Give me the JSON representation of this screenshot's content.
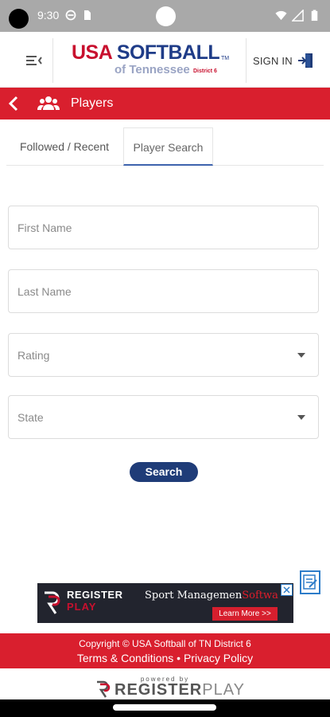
{
  "status_bar": {
    "time": "9:30"
  },
  "header": {
    "logo": {
      "usa": "USA",
      "softball": "SOFTBALL",
      "tm": "TM",
      "state": "of Tennessee",
      "district": "District 6"
    },
    "sign_in_label": "SIGN IN"
  },
  "section": {
    "title": "Players"
  },
  "tabs": [
    {
      "label": "Followed / Recent",
      "active": false
    },
    {
      "label": "Player Search",
      "active": true
    }
  ],
  "form": {
    "first_name_placeholder": "First Name",
    "last_name_placeholder": "Last Name",
    "rating_label": "Rating",
    "state_label": "State",
    "search_label": "Search"
  },
  "ad": {
    "brand_top": "REGISTER",
    "brand_bottom": "PLAY",
    "tagline_main": "Sport Managemen",
    "tagline_accent": "Softwa",
    "cta": "Learn More >>"
  },
  "footer": {
    "copyright": "Copyright © USA Softball of TN District 6",
    "terms": "Terms & Conditions",
    "separator": "•",
    "privacy": "Privacy Policy",
    "powered_by": "powered by",
    "powered_register": "REGISTER",
    "powered_play": "PLAY"
  },
  "colors": {
    "brand_red": "#d91f2e",
    "brand_navy": "#1f3c78",
    "tab_underline": "#3d63ad"
  },
  "icons": [
    "wifi-icon",
    "signal-icon",
    "battery-icon",
    "menu-icon",
    "sign-in-icon",
    "back-arrow-icon",
    "users-icon",
    "dropdown-caret-icon",
    "close-icon",
    "notes-icon"
  ]
}
